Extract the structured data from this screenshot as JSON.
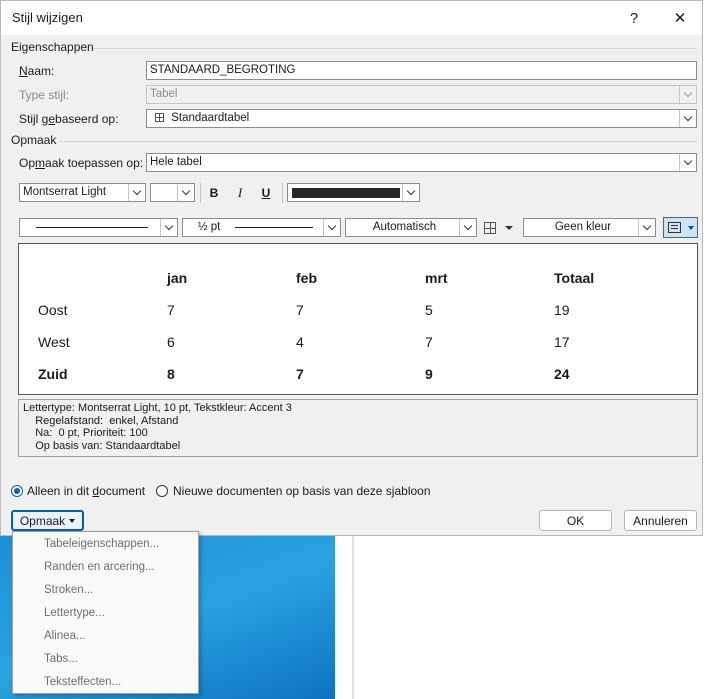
{
  "dialog": {
    "title": "Stijl wijzigen",
    "help_icon": "?",
    "close_icon": "✕"
  },
  "properties": {
    "section_label": "Eigenschappen",
    "name_label": "Naam:",
    "name_value": "STANDAARD_BEGROTING",
    "type_label": "Type stijl:",
    "type_value": "Tabel",
    "based_on_label": "Stijl gebaseerd op:",
    "based_on_value": "Standaardtabel"
  },
  "formatting": {
    "section_label": "Opmaak",
    "apply_to_label": "Opmaak toepassen op:",
    "apply_to_value": "Hele tabel",
    "font_name": "Montserrat Light",
    "font_size": "",
    "bold": "B",
    "italic": "I",
    "underline": "U",
    "text_color": "#262626",
    "border_weight": "½ pt",
    "border_color": "Automatisch",
    "shading": "Geen kleur"
  },
  "preview": {
    "header": [
      "",
      "jan",
      "feb",
      "mrt",
      "Totaal"
    ],
    "rows": [
      [
        "Oost",
        "7",
        "7",
        "5",
        "19"
      ],
      [
        "West",
        "6",
        "4",
        "7",
        "17"
      ],
      [
        "Zuid",
        "8",
        "7",
        "9",
        "24"
      ]
    ]
  },
  "description": [
    "Lettertype: Montserrat Light, 10 pt, Tekstkleur: Accent 3",
    "    Regelafstand:  enkel, Afstand",
    "    Na:  0 pt, Prioriteit: 100",
    "    Op basis van: Standaardtabel"
  ],
  "options": {
    "only_this_document": "Alleen in dit document",
    "new_documents": "Nieuwe documenten op basis van deze sjabloon",
    "selected": "only_this_document"
  },
  "buttons": {
    "format": "Opmaak",
    "ok": "OK",
    "cancel": "Annuleren"
  },
  "format_menu": [
    "Tabeleigenschappen...",
    "Randen en arcering...",
    "Stroken...",
    "Lettertype...",
    "Alinea...",
    "Tabs...",
    "Teksteffecten..."
  ]
}
